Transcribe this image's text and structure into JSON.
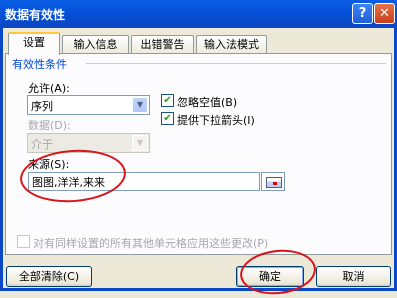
{
  "window": {
    "title": "数据有效性",
    "help_glyph": "?",
    "close_glyph": "✕"
  },
  "tabs": [
    {
      "label": "设置",
      "active": true
    },
    {
      "label": "输入信息",
      "active": false
    },
    {
      "label": "出错警告",
      "active": false
    },
    {
      "label": "输入法模式",
      "active": false
    }
  ],
  "settings": {
    "group_title": "有效性条件",
    "allow_label": "允许(A):",
    "allow_value": "序列",
    "data_label": "数据(D):",
    "data_value": "介于",
    "ignore_blank": {
      "label": "忽略空值(B)",
      "checked": true
    },
    "in_cell_dropdown": {
      "label": "提供下拉箭头(I)",
      "checked": true
    },
    "source_label": "来源(S):",
    "source_value": "图图,洋洋,来来",
    "apply_all_label": "对有同样设置的所有其他单元格应用这些更改(P)",
    "apply_all_checked": false
  },
  "buttons": {
    "clear_all": "全部清除(C)",
    "ok": "确定",
    "cancel": "取消"
  },
  "colors": {
    "title_bar": "#0a5ee4",
    "dialog_bg": "#ece9d8",
    "annotation": "#d8141b",
    "group_title": "#0046d5"
  }
}
